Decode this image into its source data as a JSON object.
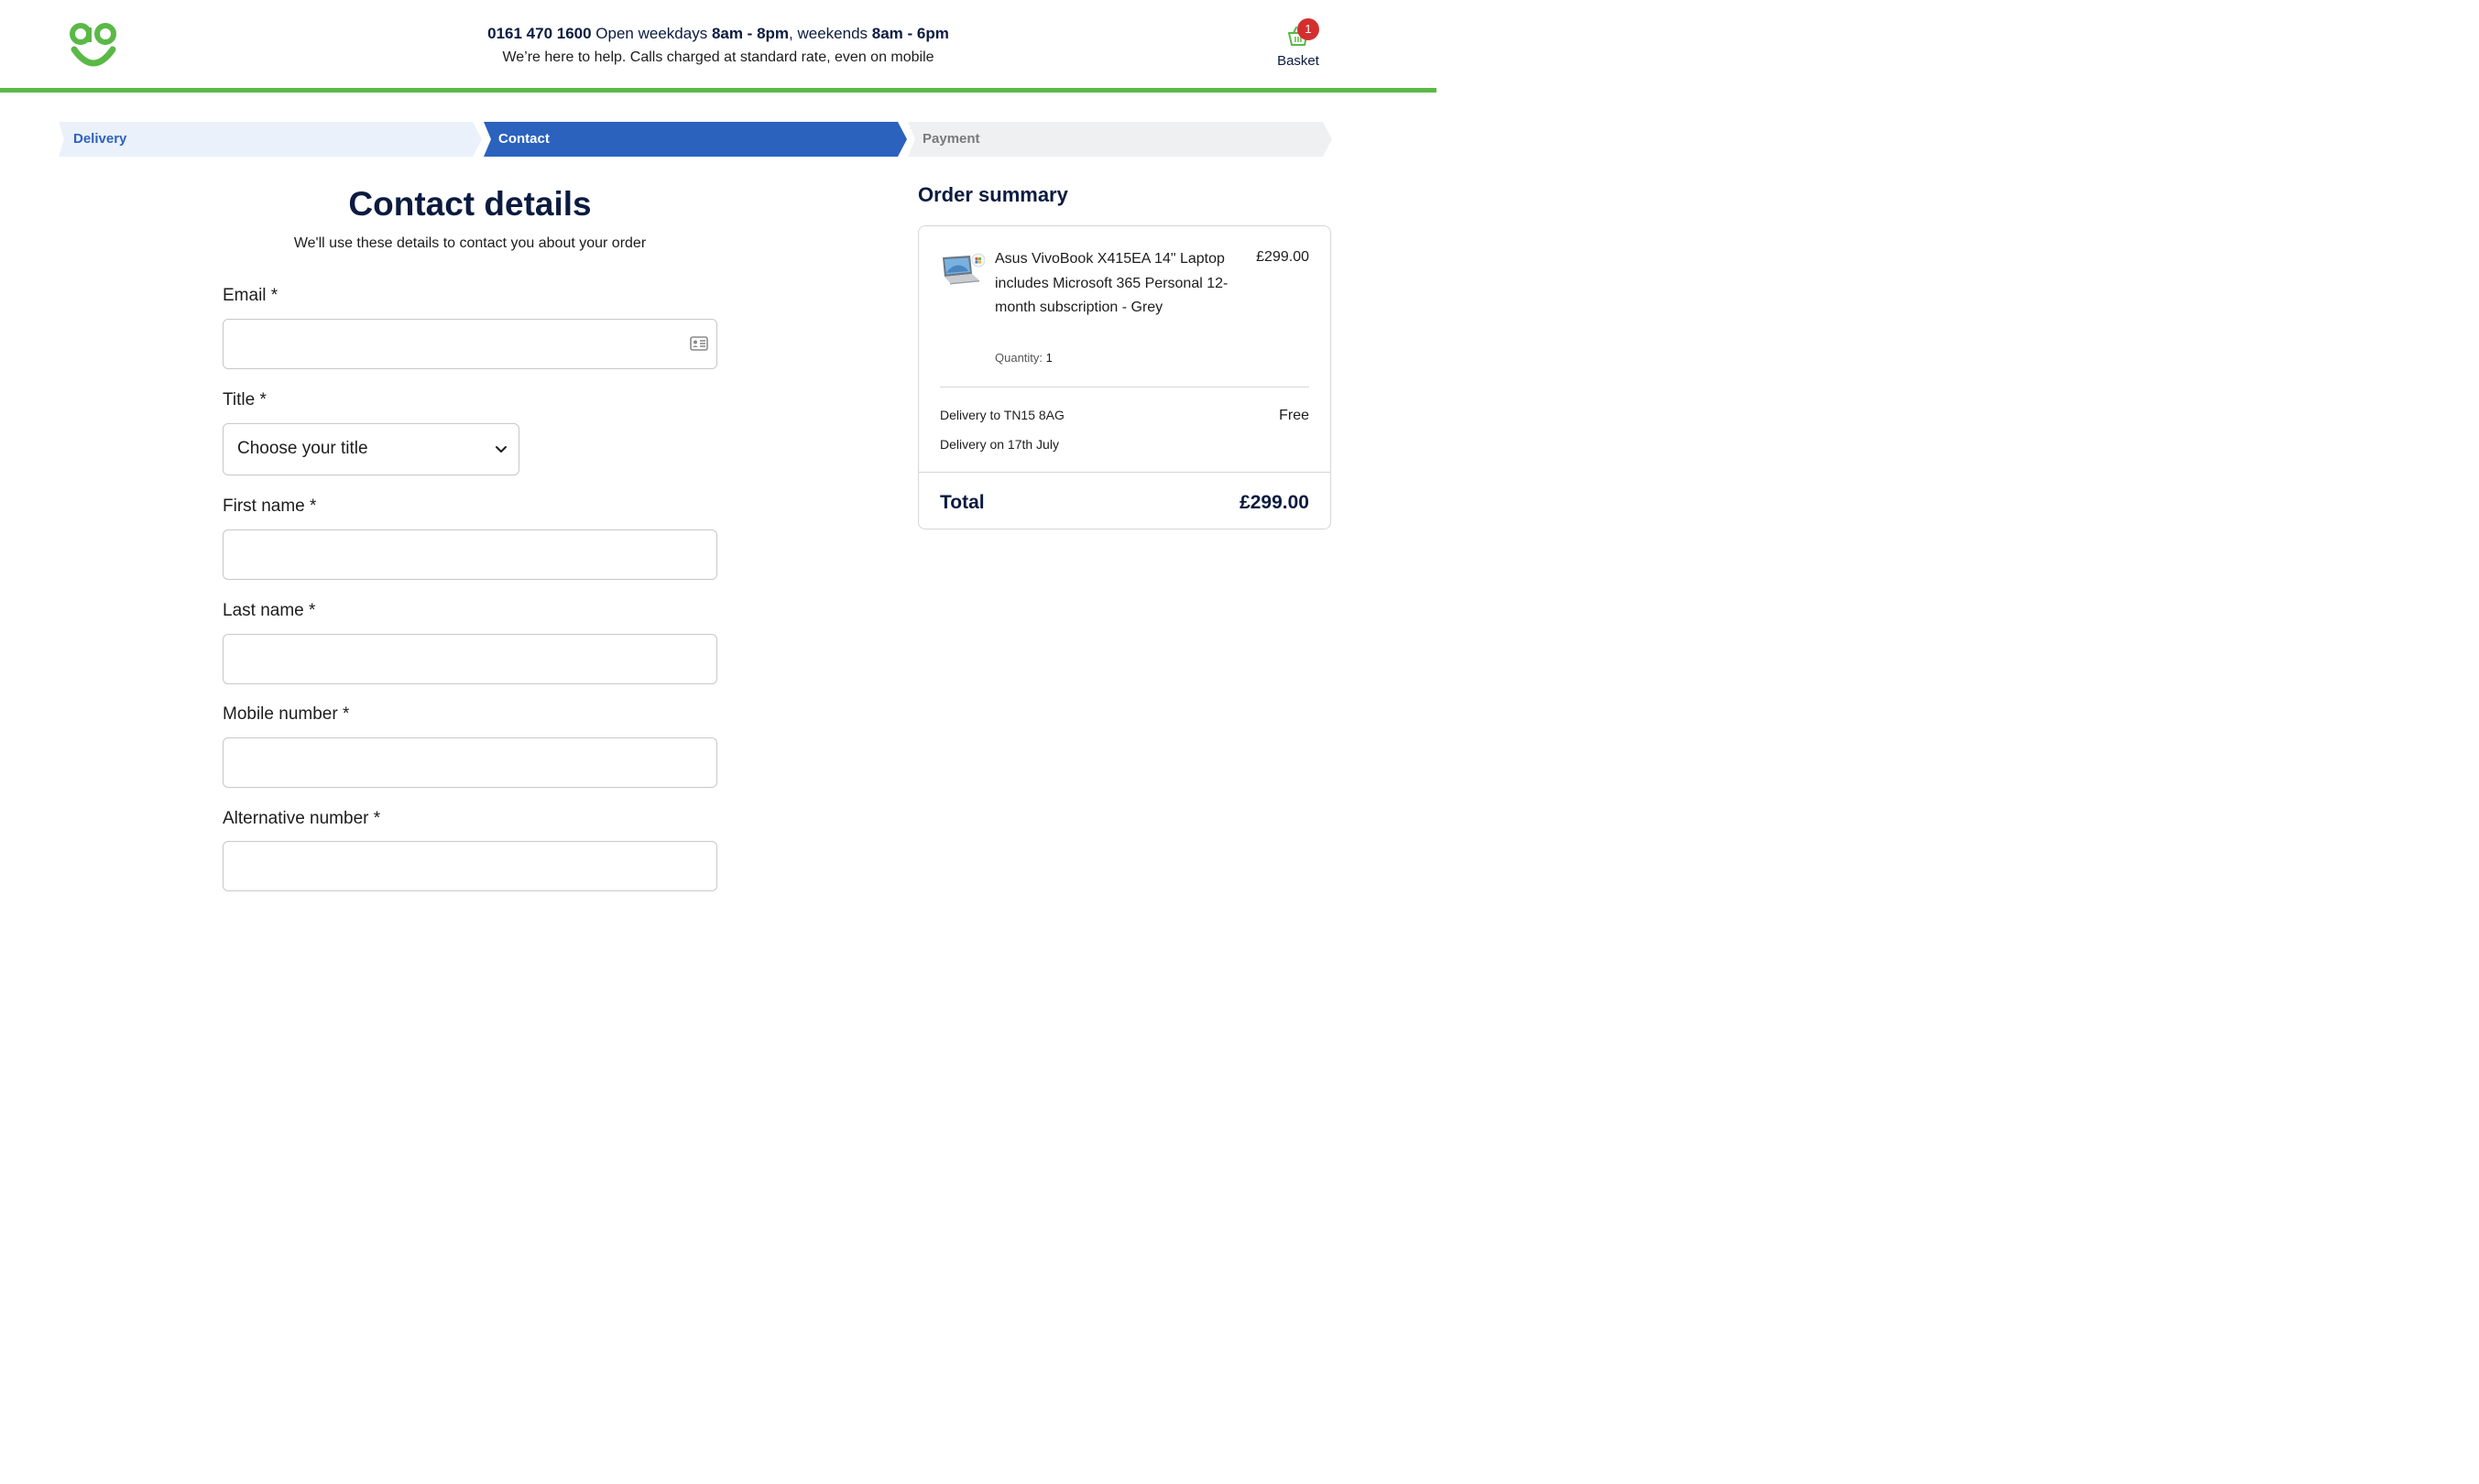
{
  "header": {
    "phone": "0161 470 1600",
    "open_text": " Open weekdays ",
    "weekday_hours": "8am - 8pm",
    "weekend_text": ", weekends ",
    "weekend_hours": "8am - 6pm",
    "help_text": "We’re here to help. Calls charged at standard rate, even on mobile",
    "basket_label": "Basket",
    "basket_count": "1"
  },
  "steps": {
    "delivery": "Delivery",
    "contact": "Contact",
    "payment": "Payment",
    "active": "Contact"
  },
  "form": {
    "title": "Contact details",
    "subtitle": "We'll use these details to contact you about your order",
    "email_label": "Email *",
    "email_value": "",
    "title_label": "Title *",
    "title_select_value": "Choose your title",
    "first_name_label": "First name *",
    "first_name_value": "",
    "last_name_label": "Last name *",
    "last_name_value": "",
    "mobile_label": "Mobile number *",
    "mobile_value": "",
    "alt_label": "Alternative number *",
    "alt_value": ""
  },
  "summary": {
    "heading": "Order summary",
    "product_name": "Asus VivoBook X415EA 14\" Laptop includes Microsoft 365 Personal 12-month subscription - Grey",
    "product_price": "£299.00",
    "quantity_label": "Quantity: ",
    "quantity": "1",
    "delivery_to": "Delivery to TN15 8AG",
    "delivery_on": "Delivery on 17th July",
    "delivery_cost": "Free",
    "total_label": "Total",
    "total_value": "£299.00"
  },
  "colors": {
    "brand_green": "#5ab946",
    "step_active": "#2a62be",
    "navy_text": "#0b1b40",
    "badge_red": "#d32f2f"
  },
  "icons": [
    "ao-logo",
    "basket-icon",
    "contact-card-icon",
    "chevron-down-icon",
    "laptop-thumbnail"
  ]
}
